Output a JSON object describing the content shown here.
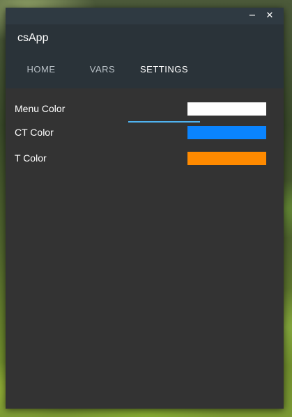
{
  "window": {
    "minimize_label": "−",
    "close_label": "✕"
  },
  "app": {
    "title": "csApp"
  },
  "tabs": [
    {
      "label": "HOME",
      "active": false
    },
    {
      "label": "VARS",
      "active": false
    },
    {
      "label": "SETTINGS",
      "active": true
    }
  ],
  "settings": [
    {
      "label": "Menu Color",
      "color": "#ffffff"
    },
    {
      "label": "CT Color",
      "color": "#0a84ff"
    },
    {
      "label": "T Color",
      "color": "#ff8a00"
    }
  ],
  "colors": {
    "accent": "#4fb3f0",
    "window_bg": "#333333",
    "header_bg": "#2a3339"
  }
}
